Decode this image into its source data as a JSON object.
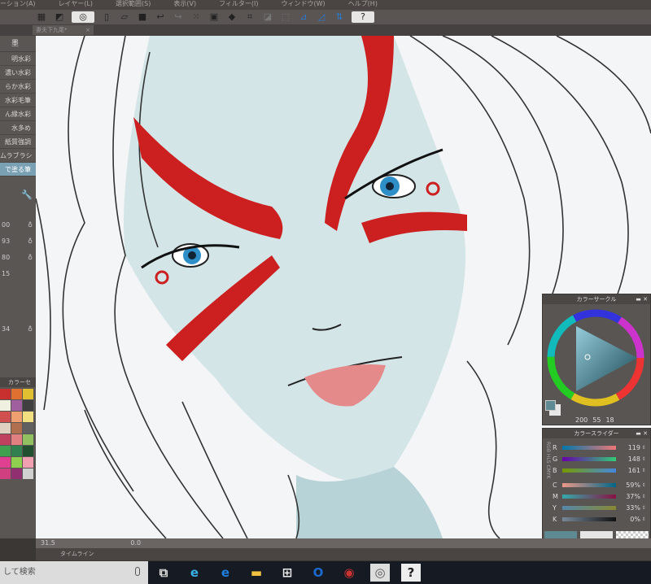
{
  "menu": [
    "ーション(A)",
    "レイヤー(L)",
    "選択範囲(S)",
    "表示(V)",
    "フィルター(I)",
    "ウィンドウ(W)",
    "ヘルプ(H)"
  ],
  "toolbar": {
    "help_label": "?"
  },
  "document_tab": {
    "title": "妻夫下九尾*",
    "close": "×"
  },
  "brush_panel": {
    "header": "墨",
    "items": [
      "明水彩",
      "濃い水彩",
      "らか水彩",
      "水彩毛筆",
      "ん縁水彩",
      "水多め",
      "紙質強調",
      "ムラブラシ",
      "で塗る筆"
    ],
    "selected_index": 8,
    "params": [
      "00",
      "93",
      "80",
      "15",
      "34"
    ]
  },
  "color_set": {
    "title": "カラーセ",
    "colors": [
      "#c83030",
      "#e07030",
      "#e0c030",
      "#f0f0e0",
      "#a060a0",
      "#404040",
      "#d05050",
      "#f0a070",
      "#f0e080",
      "#e0d0c0",
      "#b07050",
      "#606060",
      "#c04060",
      "#e08080",
      "#90c060",
      "#40a050",
      "#308050",
      "#205030",
      "#e04090",
      "#90d050",
      "#f0a0b0",
      "#d04080",
      "#903070",
      "#d0d0d0"
    ]
  },
  "color_circle": {
    "title": "カラーサークル",
    "h": 200,
    "s": 55,
    "v": 18,
    "main_color": "#5e8a94",
    "sub_color": "#e6e6e6"
  },
  "color_slider": {
    "title": "カラースライダー",
    "modes": [
      "RGB",
      "HLS",
      "CMYK"
    ],
    "rgb": [
      {
        "label": "R",
        "value": "119"
      },
      {
        "label": "G",
        "value": "148"
      },
      {
        "label": "B",
        "value": "161"
      }
    ],
    "cmyk": [
      {
        "label": "C",
        "value": "59%"
      },
      {
        "label": "M",
        "value": "37%"
      },
      {
        "label": "Y",
        "value": "33%"
      },
      {
        "label": "K",
        "value": "0%"
      }
    ]
  },
  "status": {
    "zoom": "31.5",
    "angle": "0.0"
  },
  "timeline": {
    "label": "タイムライン"
  },
  "taskbar": {
    "search_placeholder": "して検索",
    "apps": [
      "task-view",
      "internet-explorer",
      "edge",
      "file-explorer",
      "store",
      "outlook",
      "media",
      "clip-studio",
      "clip-studio-paint"
    ]
  }
}
